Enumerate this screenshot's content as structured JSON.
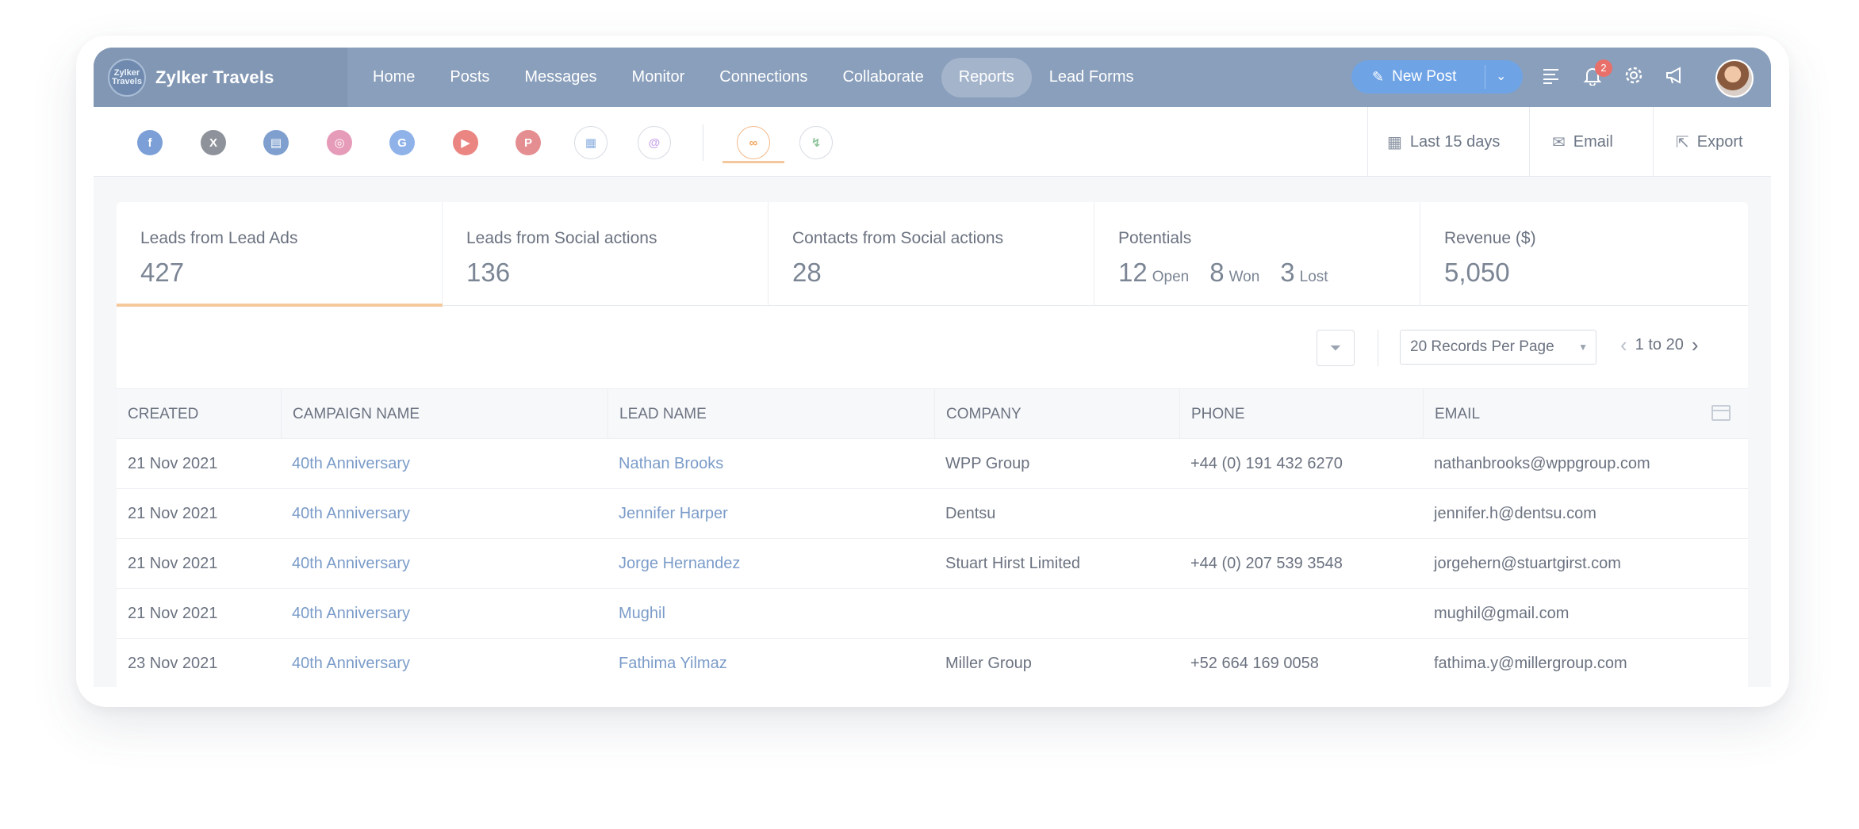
{
  "brand": {
    "name": "Zylker Travels",
    "logo_text": "Zylker Travels"
  },
  "nav": {
    "items": [
      {
        "label": "Home",
        "active": false
      },
      {
        "label": "Posts",
        "active": false
      },
      {
        "label": "Messages",
        "active": false
      },
      {
        "label": "Monitor",
        "active": false
      },
      {
        "label": "Connections",
        "active": false
      },
      {
        "label": "Collaborate",
        "active": false
      },
      {
        "label": "Reports",
        "active": true
      },
      {
        "label": "Lead Forms",
        "active": false
      }
    ],
    "new_post_label": "New Post",
    "notification_count": "2"
  },
  "networks": [
    {
      "name": "facebook-icon",
      "glyph": "f",
      "color": "#7b9fd6"
    },
    {
      "name": "x-icon",
      "glyph": "X",
      "color": "#8e939b"
    },
    {
      "name": "linkedin-page-icon",
      "glyph": "▤",
      "color": "#7fa0cf"
    },
    {
      "name": "instagram-icon",
      "glyph": "◎",
      "color": "#e69bb8"
    },
    {
      "name": "google-icon",
      "glyph": "G",
      "color": "#8fb2e8"
    },
    {
      "name": "youtube-icon",
      "glyph": "▶",
      "color": "#ea8582"
    },
    {
      "name": "pinterest-icon",
      "glyph": "P",
      "color": "#e58e92"
    },
    {
      "name": "google-business-icon",
      "glyph": "▦",
      "color": "#8aaee0"
    },
    {
      "name": "threads-icon",
      "glyph": "@",
      "color": "#c9a6e8"
    },
    {
      "name": "crm-integration-icon",
      "glyph": "∞",
      "color": "#f2a65f"
    },
    {
      "name": "zoho-crm-icon",
      "glyph": "↯",
      "color": "#8cc49b"
    }
  ],
  "toolbar": {
    "date_range": "Last 15 days",
    "email_label": "Email",
    "export_label": "Export"
  },
  "stats": {
    "lead_ads": {
      "label": "Leads from Lead Ads",
      "value": "427"
    },
    "social_leads": {
      "label": "Leads from Social actions",
      "value": "136"
    },
    "social_contacts": {
      "label": "Contacts from Social actions",
      "value": "28"
    },
    "potentials": {
      "label": "Potentials",
      "open_value": "12",
      "open_label": "Open",
      "won_value": "8",
      "won_label": "Won",
      "lost_value": "3",
      "lost_label": "Lost"
    },
    "revenue": {
      "label": "Revenue ($)",
      "value": "5,050"
    }
  },
  "pagination": {
    "per_page": "20 Records Per Page",
    "range": "1 to 20"
  },
  "table": {
    "headers": {
      "created": "CREATED",
      "campaign": "CAMPAIGN NAME",
      "lead": "LEAD NAME",
      "company": "COMPANY",
      "phone": "PHONE",
      "email": "EMAIL"
    },
    "rows": [
      {
        "created": "21 Nov 2021",
        "campaign": "40th Anniversary",
        "lead": "Nathan Brooks",
        "company": "WPP Group",
        "phone": "+44 (0) 191 432 6270",
        "email": "nathanbrooks@wppgroup.com"
      },
      {
        "created": "21 Nov 2021",
        "campaign": "40th Anniversary",
        "lead": "Jennifer Harper",
        "company": "Dentsu",
        "phone": "",
        "email": "jennifer.h@dentsu.com"
      },
      {
        "created": "21 Nov 2021",
        "campaign": "40th Anniversary",
        "lead": "Jorge Hernandez",
        "company": "Stuart Hirst Limited",
        "phone": "+44 (0) 207 539 3548",
        "email": "jorgehern@stuartgirst.com"
      },
      {
        "created": "21 Nov 2021",
        "campaign": "40th Anniversary",
        "lead": "Mughil",
        "company": "",
        "phone": "",
        "email": "mughil@gmail.com"
      },
      {
        "created": "23 Nov 2021",
        "campaign": "40th Anniversary",
        "lead": "Fathima Yilmaz",
        "company": "Miller Group",
        "phone": "+52 664 169 0058",
        "email": "fathima.y@millergroup.com"
      }
    ]
  }
}
